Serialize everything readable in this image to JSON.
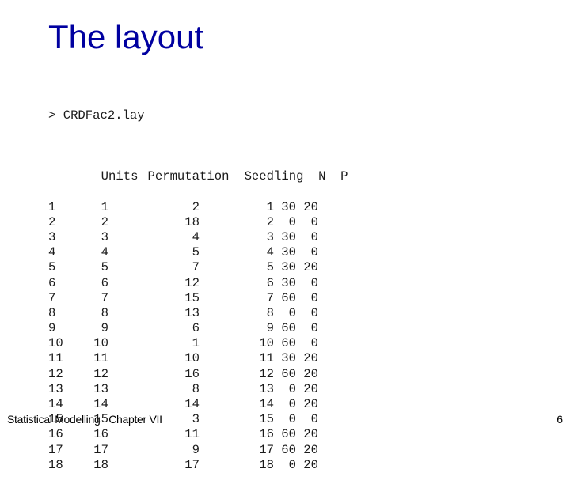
{
  "slide": {
    "title": "The layout",
    "title_color": "#0000A0"
  },
  "console": {
    "command": "> CRDFac2.lay",
    "columns": [
      "",
      "Units",
      "Permutation",
      "Seedling",
      "N",
      "P"
    ],
    "rows": [
      [
        "1",
        "1",
        "2",
        "1",
        "30",
        "20"
      ],
      [
        "2",
        "2",
        "18",
        "2",
        "0",
        "0"
      ],
      [
        "3",
        "3",
        "4",
        "3",
        "30",
        "0"
      ],
      [
        "4",
        "4",
        "5",
        "4",
        "30",
        "0"
      ],
      [
        "5",
        "5",
        "7",
        "5",
        "30",
        "20"
      ],
      [
        "6",
        "6",
        "12",
        "6",
        "30",
        "0"
      ],
      [
        "7",
        "7",
        "15",
        "7",
        "60",
        "0"
      ],
      [
        "8",
        "8",
        "13",
        "8",
        "0",
        "0"
      ],
      [
        "9",
        "9",
        "6",
        "9",
        "60",
        "0"
      ],
      [
        "10",
        "10",
        "1",
        "10",
        "60",
        "0"
      ],
      [
        "11",
        "11",
        "10",
        "11",
        "30",
        "20"
      ],
      [
        "12",
        "12",
        "16",
        "12",
        "60",
        "20"
      ],
      [
        "13",
        "13",
        "8",
        "13",
        "0",
        "20"
      ],
      [
        "14",
        "14",
        "14",
        "14",
        "0",
        "20"
      ],
      [
        "15",
        "15",
        "3",
        "15",
        "0",
        "0"
      ],
      [
        "16",
        "16",
        "11",
        "16",
        "60",
        "20"
      ],
      [
        "17",
        "17",
        "9",
        "17",
        "60",
        "20"
      ],
      [
        "18",
        "18",
        "17",
        "18",
        "0",
        "20"
      ]
    ]
  },
  "footer": {
    "left": "Statistical Modelling   Chapter VII",
    "page_number": "6"
  }
}
